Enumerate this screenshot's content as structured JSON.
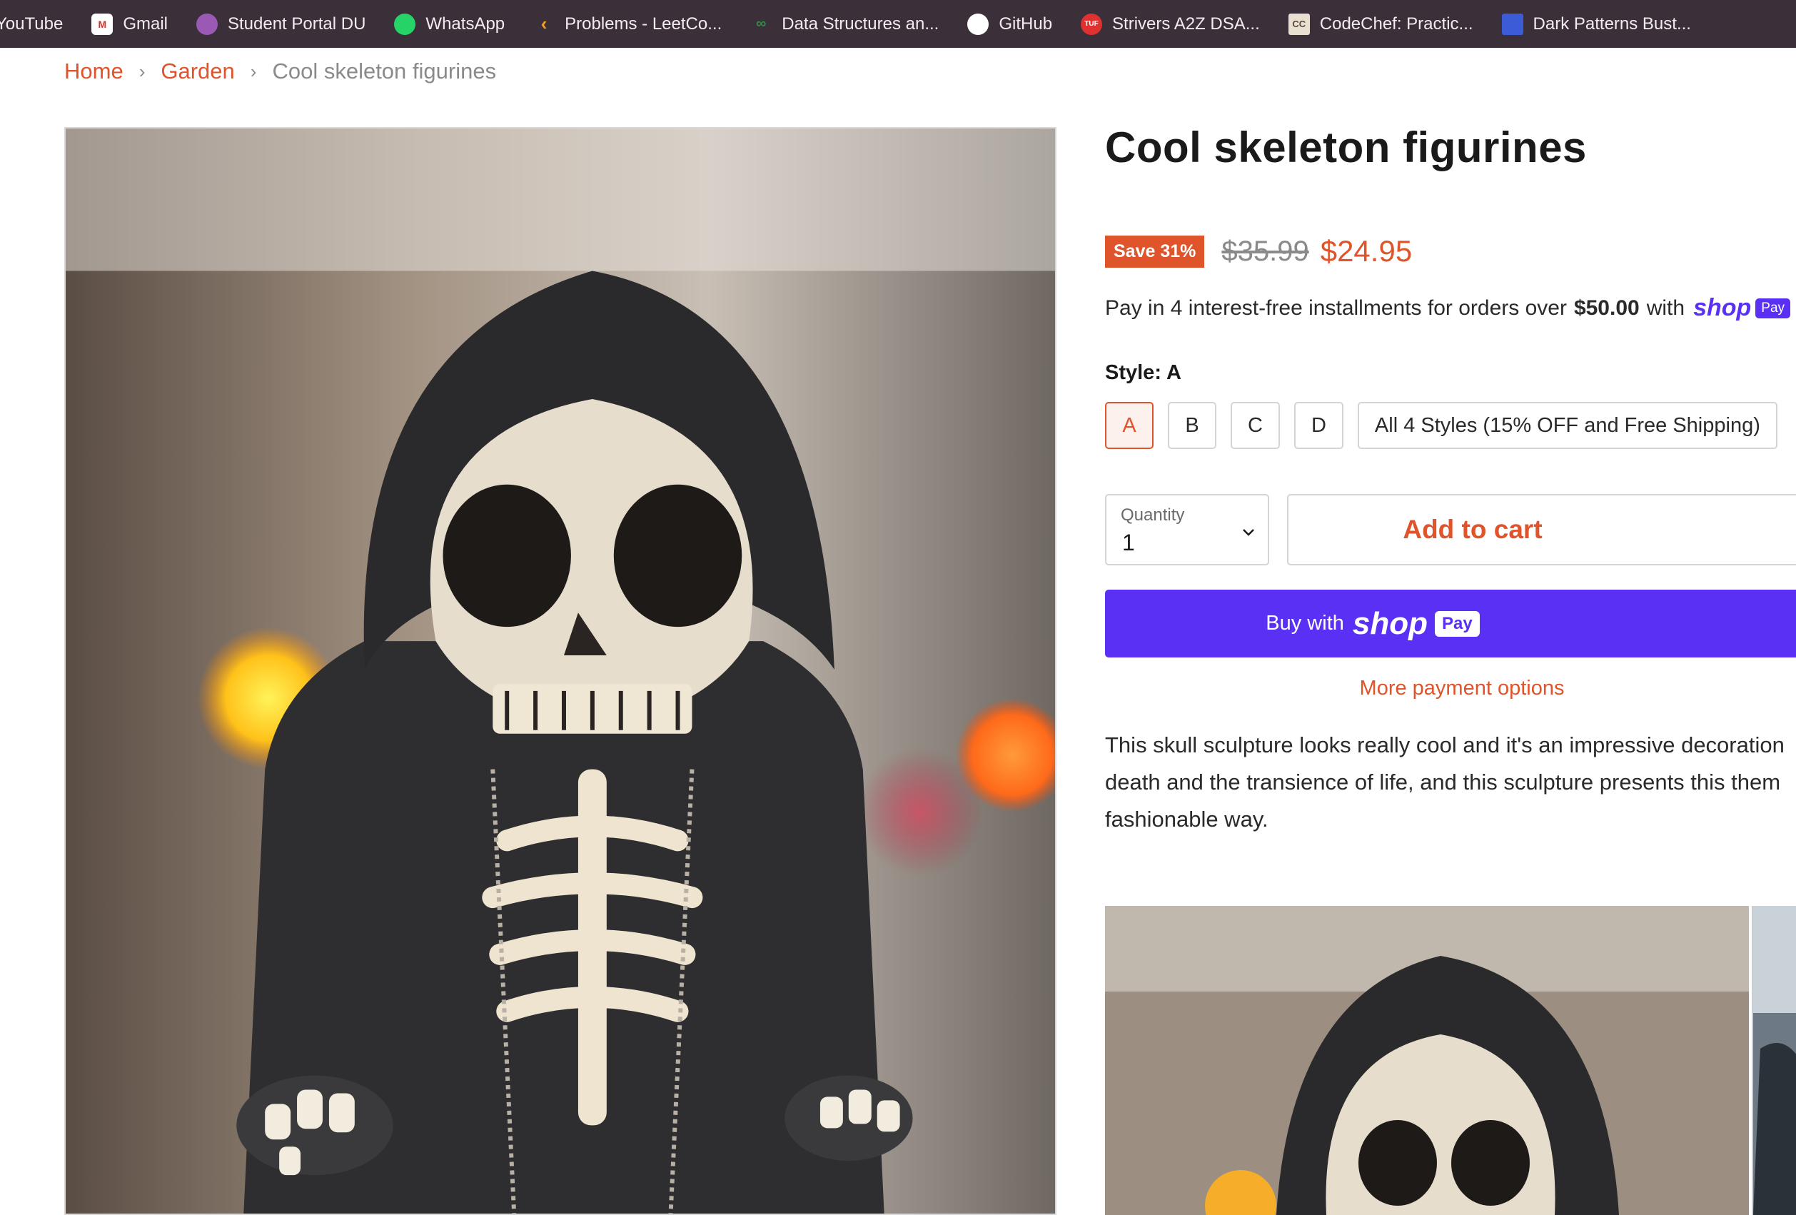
{
  "bookmarks": [
    {
      "label": "YouTube",
      "icon": "youtube-icon"
    },
    {
      "label": "Gmail",
      "icon": "gmail-icon"
    },
    {
      "label": "Student Portal DU",
      "icon": "portal-icon"
    },
    {
      "label": "WhatsApp",
      "icon": "whatsapp-icon"
    },
    {
      "label": "Problems - LeetCo...",
      "icon": "leetcode-icon"
    },
    {
      "label": "Data Structures an...",
      "icon": "gfg-icon"
    },
    {
      "label": "GitHub",
      "icon": "github-icon"
    },
    {
      "label": "Strivers A2Z DSA...",
      "icon": "tuf-icon"
    },
    {
      "label": "CodeChef: Practic...",
      "icon": "codechef-icon"
    },
    {
      "label": "Dark Patterns Bust...",
      "icon": "darkpatterns-icon"
    }
  ],
  "bookmark_icon_text": {
    "gmail": "M",
    "tuf": "TUF",
    "codechef": "CC"
  },
  "breadcrumb": {
    "home": "Home",
    "garden": "Garden",
    "current": "Cool skeleton figurines",
    "separator": "›"
  },
  "product": {
    "title": "Cool skeleton figurines",
    "save_badge": "Save 31%",
    "old_price": "$35.99",
    "new_price": "$24.95",
    "installments_prefix": "Pay in 4 interest-free installments for orders over",
    "installments_amount": "$50.00",
    "installments_suffix": "with",
    "shop_logo": "shop",
    "pay_badge": "Pay",
    "style_label": "Style:",
    "style_value": "A",
    "styles": [
      "A",
      "B",
      "C",
      "D",
      "All 4 Styles (15% OFF and Free Shipping)"
    ],
    "selected_style": "A",
    "quantity_label": "Quantity",
    "quantity_value": "1",
    "add_to_cart": "Add to cart",
    "buy_with": "Buy with",
    "buy_shop": "shop",
    "buy_pay": "Pay",
    "more_payment": "More payment options",
    "description_lines": [
      "This skull sculpture looks really cool and it's an impressive decoration",
      "death and the transience of life, and this sculpture presents this them",
      "fashionable way."
    ]
  },
  "colors": {
    "accent": "#e0542b",
    "shop_purple": "#5a31f4",
    "bookmarks_bg": "#3b2f3a"
  }
}
